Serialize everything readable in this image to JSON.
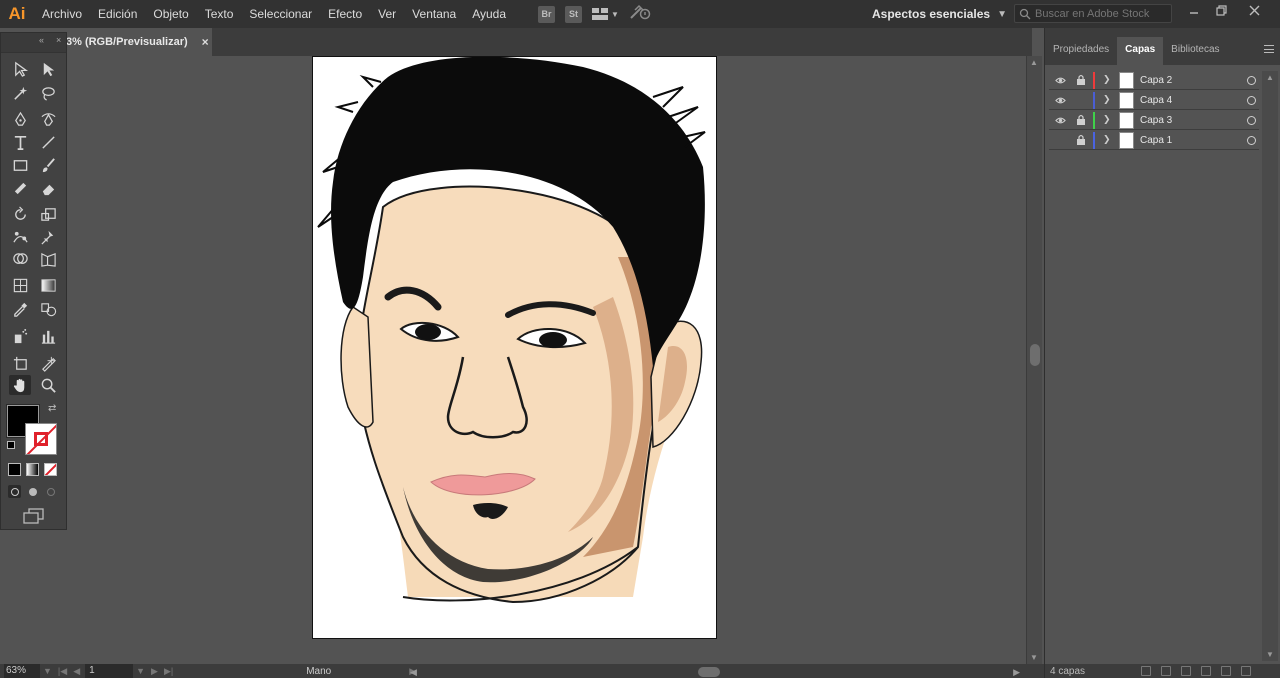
{
  "app": {
    "logo": "Ai"
  },
  "menu": [
    "Archivo",
    "Edición",
    "Objeto",
    "Texto",
    "Seleccionar",
    "Efecto",
    "Ver",
    "Ventana",
    "Ayuda"
  ],
  "menu_icons": [
    {
      "name": "bridge-icon",
      "label": "Br"
    },
    {
      "name": "stock-icon",
      "label": "St"
    }
  ],
  "workspace": {
    "label": "Aspectos esenciales"
  },
  "search": {
    "placeholder": "Buscar en Adobe Stock"
  },
  "document": {
    "tab_label": "3% (RGB/Previsualizar)",
    "close": "×"
  },
  "statusbar": {
    "zoom": "63%",
    "artboard": "1",
    "tool": "Mano"
  },
  "panel": {
    "tabs": [
      "Propiedades",
      "Capas",
      "Bibliotecas"
    ],
    "active_tab": "Capas",
    "layers": [
      {
        "name": "Capa 2",
        "visible": true,
        "locked": true,
        "color": "#ef3b3b"
      },
      {
        "name": "Capa 4",
        "visible": true,
        "locked": false,
        "color": "#4a5ed4"
      },
      {
        "name": "Capa 3",
        "visible": true,
        "locked": true,
        "color": "#3fd14a"
      },
      {
        "name": "Capa 1",
        "visible": false,
        "locked": true,
        "color": "#4a63e0"
      }
    ],
    "footer": "4 capas"
  },
  "colors": {
    "accent": "#f7962a",
    "menubar": "#323232",
    "canvas": "#535353",
    "skin": "#f7dcbc",
    "skin_shadow": "#c9956e",
    "lips": "#ef9a9a"
  },
  "tools": [
    "selection-tool",
    "direct-selection-tool",
    "magic-wand-tool",
    "lasso-tool",
    "pen-tool",
    "curvature-tool",
    "type-tool",
    "line-tool",
    "rectangle-tool",
    "paintbrush-tool",
    "shaper-tool",
    "eraser-tool",
    "rotate-tool",
    "scale-tool",
    "puppet-warp-tool",
    "pin-tool",
    "shape-builder-tool",
    "perspective-grid-tool",
    "mesh-tool",
    "gradient-tool",
    "eyedropper-tool",
    "blend-tool",
    "symbol-sprayer-tool",
    "column-graph-tool",
    "artboard-tool",
    "slice-tool",
    "hand-tool",
    "zoom-tool"
  ]
}
